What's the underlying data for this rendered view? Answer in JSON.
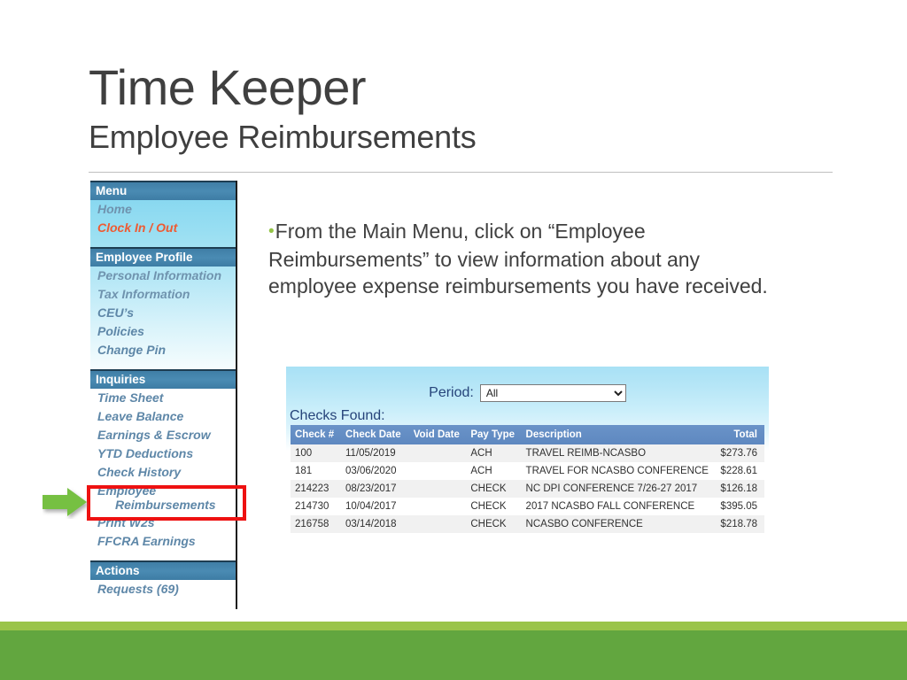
{
  "slide": {
    "title": "Time Keeper",
    "subtitle": "Employee Reimbursements",
    "bullet": "From the Main Menu, click on “Employee Reimbursements” to view information about any employee expense reimbursements you have received."
  },
  "colors": {
    "accent_green": "#62a63f",
    "accent_green_light": "#9ac44a",
    "highlight_red": "#ee1111",
    "arrow_green": "#76c043",
    "menu_header_blue": "#3f7ea6",
    "menu_link_blue": "#5e87a8",
    "menu_alert_orange": "#ef5a32",
    "table_header_blue": "#6a93c8",
    "panel_cyan": "#a8e1f5"
  },
  "menu": {
    "sections": [
      {
        "title": "Menu",
        "items": [
          {
            "label": "Home",
            "style": "muted"
          },
          {
            "label": "Clock In  / Out",
            "style": "alert"
          }
        ]
      },
      {
        "title": "Employee Profile",
        "items": [
          {
            "label": "Personal Information",
            "style": "muted"
          },
          {
            "label": "Tax Information",
            "style": "muted"
          },
          {
            "label": "CEU’s",
            "style": "normal"
          },
          {
            "label": "Policies",
            "style": "normal"
          },
          {
            "label": "Change Pin",
            "style": "normal"
          }
        ]
      },
      {
        "title": "Inquiries",
        "items": [
          {
            "label": "Time Sheet",
            "style": "normal"
          },
          {
            "label": "Leave Balance",
            "style": "normal"
          },
          {
            "label": "Earnings & Escrow",
            "style": "normal"
          },
          {
            "label": "YTD Deductions",
            "style": "normal"
          },
          {
            "label": "Check History",
            "style": "normal"
          },
          {
            "label": "Employee",
            "label2": "Reimbursements",
            "style": "normal",
            "highlighted": true
          },
          {
            "label": "Print W2s",
            "style": "normal"
          },
          {
            "label": "FFCRA Earnings",
            "style": "normal"
          }
        ]
      },
      {
        "title": "Actions",
        "items": [
          {
            "label": "Requests (69)",
            "style": "normal"
          }
        ]
      }
    ]
  },
  "app": {
    "period_label": "Period:",
    "period_value": "All",
    "period_options": [
      "All"
    ],
    "checks_found_label": "Checks Found:",
    "table": {
      "columns": [
        "Check #",
        "Check Date",
        "Void Date",
        "Pay Type",
        "Description",
        "Total"
      ],
      "rows": [
        [
          "100",
          "11/05/2019",
          "",
          "ACH",
          "TRAVEL REIMB-NCASBO",
          "$273.76"
        ],
        [
          "181",
          "03/06/2020",
          "",
          "ACH",
          "TRAVEL FOR NCASBO CONFERENCE",
          "$228.61"
        ],
        [
          "214223",
          "08/23/2017",
          "",
          "CHECK",
          "NC DPI CONFERENCE 7/26-27 2017",
          "$126.18"
        ],
        [
          "214730",
          "10/04/2017",
          "",
          "CHECK",
          "2017 NCASBO FALL CONFERENCE",
          "$395.05"
        ],
        [
          "216758",
          "03/14/2018",
          "",
          "CHECK",
          "NCASBO CONFERENCE",
          "$218.78"
        ]
      ]
    }
  }
}
